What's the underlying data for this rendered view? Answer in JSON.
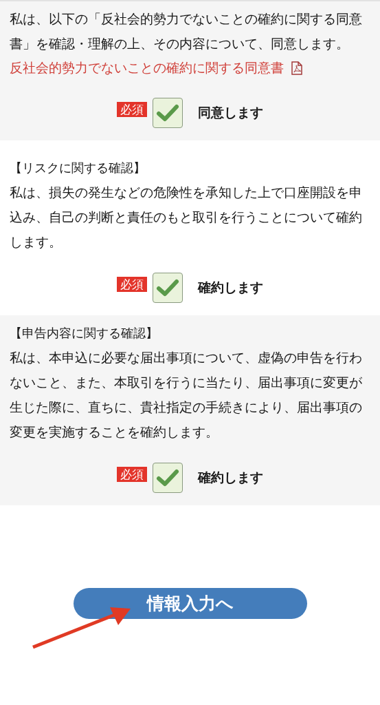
{
  "sections": [
    {
      "body": "私は、以下の「反社会的勢力でないことの確約に関する同意書」を確認・理解の上、その内容について、同意します。",
      "link": "反社会的勢力でないことの確約に関する同意書",
      "badge": "必須",
      "checked": true,
      "label": "同意します"
    },
    {
      "heading": "【リスクに関する確認】",
      "body": "私は、損失の発生などの危険性を承知した上で口座開設を申込み、自己の判断と責任のもと取引を行うことについて確約します。",
      "badge": "必須",
      "checked": true,
      "label": "確約します"
    },
    {
      "heading": "【申告内容に関する確認】",
      "body": "私は、本申込に必要な届出事項について、虚偽の申告を行わないこと、また、本取引を行うに当たり、届出事項に変更が生じた際に、直ちに、貴社指定の手続きにより、届出事項の変更を実施することを確約します。",
      "badge": "必須",
      "checked": true,
      "label": "確約します"
    }
  ],
  "submit_button": "情報入力へ"
}
